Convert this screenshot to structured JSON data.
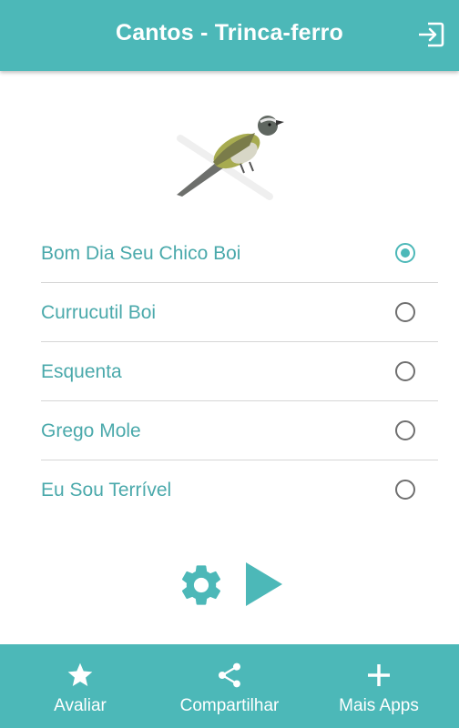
{
  "header": {
    "title": "Cantos - Trinca-ferro",
    "exit_icon": "exit-icon"
  },
  "songs": [
    {
      "label": "Bom Dia Seu Chico Boi",
      "selected": true
    },
    {
      "label": "Currucutil Boi",
      "selected": false
    },
    {
      "label": "Esquenta",
      "selected": false
    },
    {
      "label": "Grego Mole",
      "selected": false
    },
    {
      "label": "Eu Sou Terrível",
      "selected": false
    }
  ],
  "controls": {
    "settings_icon": "gear-icon",
    "play_icon": "play-icon"
  },
  "bottom_nav": [
    {
      "label": "Avaliar",
      "icon": "star-icon"
    },
    {
      "label": "Compartilhar",
      "icon": "share-icon"
    },
    {
      "label": "Mais Apps",
      "icon": "plus-icon"
    }
  ],
  "colors": {
    "accent": "#4cb8b8",
    "list_text": "#4aa9ab",
    "divider": "#d6d6d6"
  }
}
